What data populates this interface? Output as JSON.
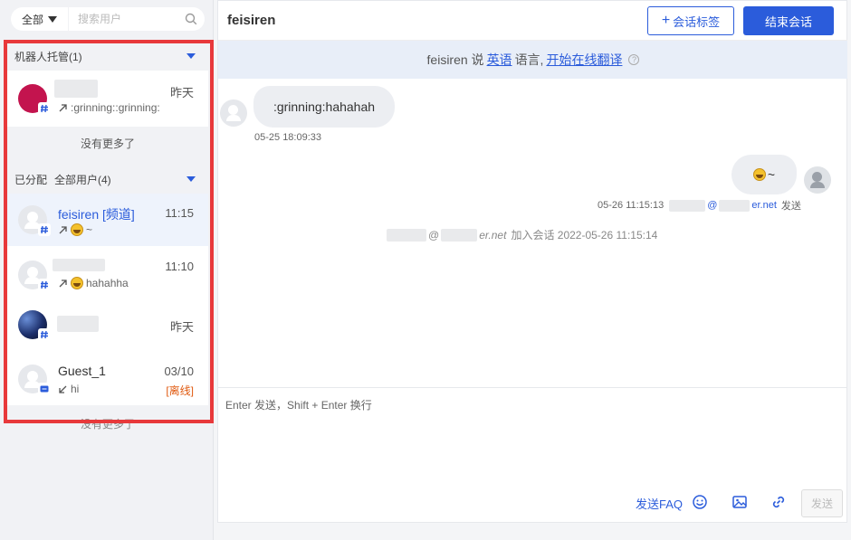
{
  "sidebar": {
    "filter_label": "全部",
    "search_placeholder": "搜索用户",
    "robot_section": {
      "title": "机器人托管(1)",
      "conversations": [
        {
          "time": "昨天",
          "preview": ":grinning::grinning:"
        }
      ],
      "no_more": "没有更多了"
    },
    "assigned_section": {
      "title": "已分配",
      "subtitle": "全部用户(4)",
      "conversations": [
        {
          "name": "feisiren [频道]",
          "time": "11:15",
          "preview": "~"
        },
        {
          "time": "11:10",
          "preview": "hahahha"
        },
        {
          "time": "昨天"
        },
        {
          "name": "Guest_1",
          "time": "03/10",
          "status": "[离线]",
          "preview": "hi"
        }
      ],
      "no_more": "没有更多了"
    }
  },
  "chat": {
    "title": "feisiren",
    "add_tag_label": "会话标签",
    "end_label": "结束会话",
    "banner": {
      "prefix": "feisiren 说",
      "language": "英语",
      "middle": "语言,",
      "translate_link": "开始在线翻译"
    },
    "messages": [
      {
        "text": ":grinning:hahahah",
        "time": "05-25 18:09:33"
      },
      {
        "text": "~",
        "time": "05-26 11:15:13",
        "domain": "er.net",
        "action": "发送"
      }
    ],
    "system_event": {
      "domain": "er.net",
      "text": "加入会话 2022-05-26 11:15:14"
    },
    "composer": {
      "placeholder": "Enter 发送，Shift + Enter 换行",
      "faq_label": "发送FAQ",
      "send_label": "发送"
    }
  },
  "colors": {
    "accent": "#2b5cdb",
    "highlight": "#e8393b",
    "offline": "#e05a10"
  }
}
